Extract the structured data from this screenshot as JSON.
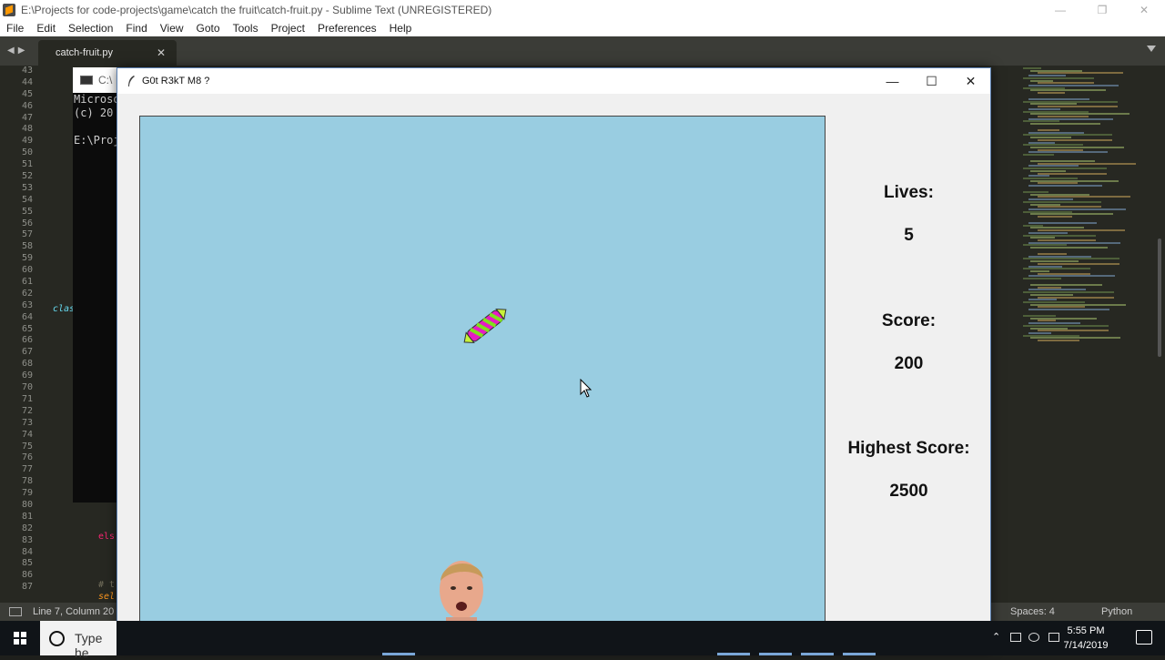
{
  "sublime": {
    "title": "E:\\Projects for code-projects\\game\\catch the fruit\\catch-fruit.py - Sublime Text (UNREGISTERED)",
    "menu": [
      "File",
      "Edit",
      "Selection",
      "Find",
      "View",
      "Goto",
      "Tools",
      "Project",
      "Preferences",
      "Help"
    ],
    "tab_label": "catch-fruit.py",
    "line_numbers": [
      "43",
      "44",
      "45",
      "46",
      "47",
      "48",
      "49",
      "50",
      "51",
      "52",
      "53",
      "54",
      "55",
      "56",
      "57",
      "58",
      "59",
      "60",
      "61",
      "62",
      "63",
      "64",
      "65",
      "66",
      "67",
      "68",
      "69",
      "70",
      "71",
      "72",
      "73",
      "74",
      "75",
      "76",
      "77",
      "78",
      "79",
      "80",
      "81",
      "82",
      "83",
      "84",
      "85",
      "86",
      "87"
    ],
    "code_fragments": {
      "cla": "clas",
      "els": "els",
      "tcomment": "# t",
      "sel": "sel"
    },
    "status_position": "Line 7, Column 20",
    "status_spaces": "Spaces: 4",
    "status_language": "Python"
  },
  "console": {
    "title": "C:\\",
    "lines": [
      "Microso",
      "(c) 20",
      "",
      "E:\\Proj"
    ]
  },
  "game": {
    "title": "G0t R3kT M8 ?",
    "lives_label": "Lives:",
    "lives_value": "5",
    "score_label": "Score:",
    "score_value": "200",
    "highest_label": "Highest Score:",
    "highest_value": "2500",
    "canvas_color": "#99cde1"
  },
  "taskbar": {
    "search_placeholder": "Type he",
    "time": "5:55 PM",
    "date": "7/14/2019"
  }
}
